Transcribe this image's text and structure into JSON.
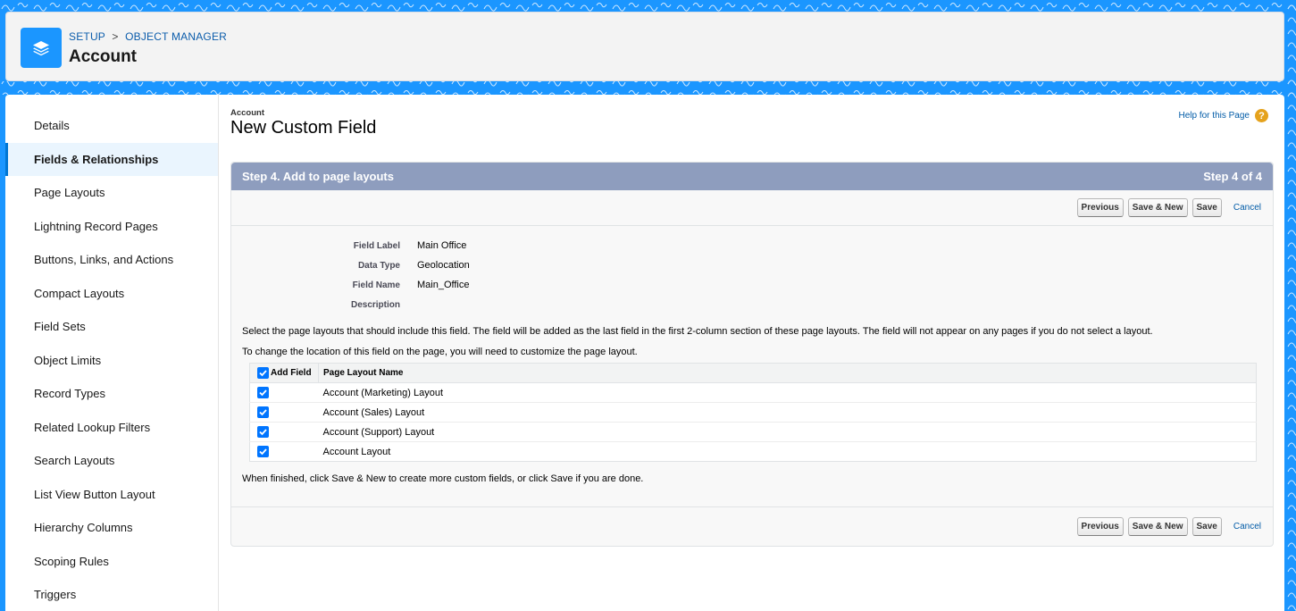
{
  "header": {
    "breadcrumb": [
      "SETUP",
      "OBJECT MANAGER"
    ],
    "breadcrumb_sep": ">",
    "title": "Account",
    "icon": "layers-icon"
  },
  "sidebar": {
    "items": [
      {
        "label": "Details"
      },
      {
        "label": "Fields & Relationships",
        "active": true
      },
      {
        "label": "Page Layouts"
      },
      {
        "label": "Lightning Record Pages"
      },
      {
        "label": "Buttons, Links, and Actions"
      },
      {
        "label": "Compact Layouts"
      },
      {
        "label": "Field Sets"
      },
      {
        "label": "Object Limits"
      },
      {
        "label": "Record Types"
      },
      {
        "label": "Related Lookup Filters"
      },
      {
        "label": "Search Layouts"
      },
      {
        "label": "List View Button Layout"
      },
      {
        "label": "Hierarchy Columns"
      },
      {
        "label": "Scoping Rules"
      },
      {
        "label": "Triggers"
      }
    ]
  },
  "page": {
    "object_label": "Account",
    "title": "New Custom Field",
    "help_label": "Help for this Page",
    "help_icon": "help-icon"
  },
  "panel": {
    "step_title": "Step 4. Add to page layouts",
    "step_count": "Step 4 of 4",
    "buttons": {
      "previous": "Previous",
      "save_new": "Save & New",
      "save": "Save",
      "cancel": "Cancel"
    },
    "fields": [
      {
        "label": "Field Label",
        "value": "Main Office"
      },
      {
        "label": "Data Type",
        "value": "Geolocation"
      },
      {
        "label": "Field Name",
        "value": "Main_Office"
      },
      {
        "label": "Description",
        "value": ""
      }
    ],
    "instruction1": "Select the page layouts that should include this field. The field will be added as the last field in the first 2-column section of these page layouts. The field will not appear on any pages if you do not select a layout.",
    "instruction2": "To change the location of this field on the page, you will need to customize the page layout.",
    "table": {
      "col_add": "Add Field",
      "col_name": "Page Layout Name",
      "header_checked": true,
      "rows": [
        {
          "name": "Account (Marketing) Layout",
          "checked": true
        },
        {
          "name": "Account (Sales) Layout",
          "checked": true
        },
        {
          "name": "Account (Support) Layout",
          "checked": true
        },
        {
          "name": "Account Layout",
          "checked": true
        }
      ]
    },
    "instruction3": "When finished, click Save & New to create more custom fields, or click Save if you are done."
  },
  "colors": {
    "brand": "#1b96ff",
    "step_header": "#8e9dbe",
    "checkbox": "#0075ff",
    "link": "#015ba7"
  }
}
